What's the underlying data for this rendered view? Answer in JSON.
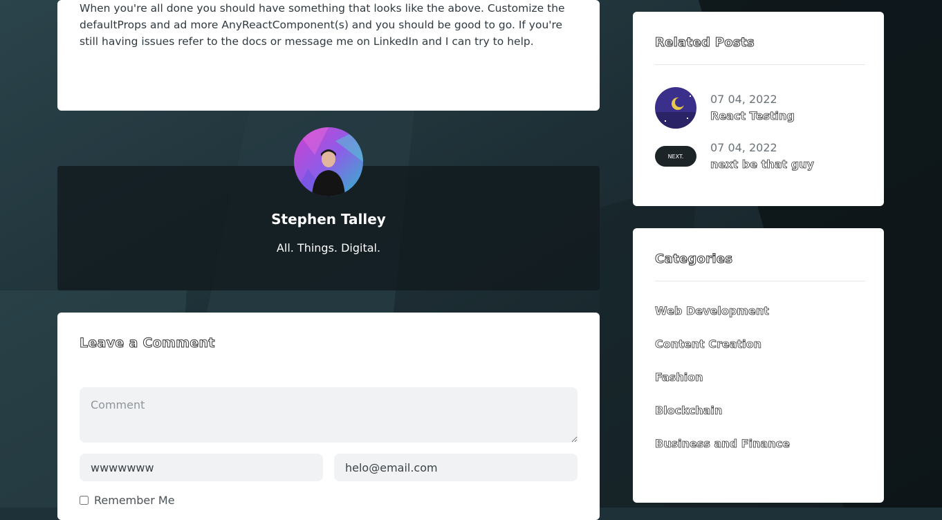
{
  "article": {
    "closing_paragraph": "When you're all done you should have something that looks like the above. Customize the defaultProps and ad more AnyReactComponent(s) and you should be good to go. If you're still having issues refer to the docs or message me on LinkedIn and I can try to help."
  },
  "author": {
    "name": "Stephen Talley",
    "tagline": "All. Things. Digital."
  },
  "comment_form": {
    "title": "Leave a Comment",
    "comment_placeholder": "Comment",
    "name_value": "wwwwwww",
    "email_value": "helo@email.com",
    "remember_label": "Remember Me"
  },
  "related_posts": {
    "title": "Related Posts",
    "posts": [
      {
        "date": "07 04, 2022",
        "title": "React Testing"
      },
      {
        "date": "07 04, 2022",
        "title": "next be that guy",
        "thumb_label": "NEXT."
      }
    ]
  },
  "categories": {
    "title": "Categories",
    "items": [
      "Web Development",
      "Content Creation",
      "Fashion",
      "Blockchain",
      "Business and Finance"
    ]
  },
  "colors": {
    "background": "#1f3138",
    "card": "#ffffff",
    "author_box": "#11191e",
    "input_bg": "#f1f2f4"
  }
}
